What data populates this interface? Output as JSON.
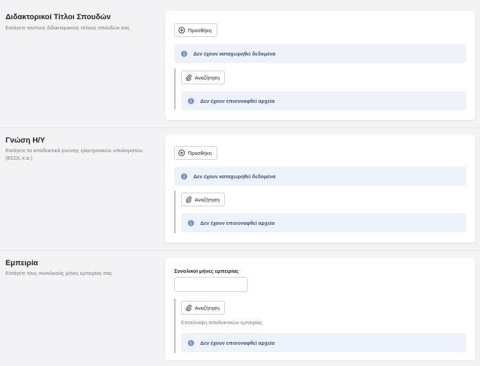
{
  "sections": [
    {
      "title": "Διδακτορικοί Τίτλοι Σπουδών",
      "description": "Εισάγετε τον/τους διδακτορικούς τίτλους σπουδών σας",
      "add_label": "Προσθήκη",
      "no_data_text": "Δεν έχουν καταχωρηθεί δεδομένα",
      "browse_label": "Αναζήτηση",
      "no_files_text": "Δεν έχουν επισυναφθεί αρχεία"
    },
    {
      "title": "Γνώση Η/Υ",
      "description": "Εισάγετε τα αποδεικτικά γνώσης ηλεκτρονικών υπολογιστών (ECDL κ.α.)",
      "add_label": "Προσθήκη",
      "no_data_text": "Δεν έχουν καταχωρηθεί δεδομένα",
      "browse_label": "Αναζήτηση",
      "no_files_text": "Δεν έχουν επισυναφθεί αρχεία"
    },
    {
      "title": "Εμπειρία",
      "description": "Εισάγετε τους συνολικούς μήνες εμπειρίας σας",
      "field_label": "Συνολικοί μήνες εμπειρίας",
      "field_value": "",
      "browse_label": "Αναζήτηση",
      "hint_text": "Επισύναψη αποδεικτικών εμπειρίας",
      "no_files_text": "Δεν έχουν επισυναφθεί αρχεία"
    }
  ],
  "colors": {
    "info_bg": "#eef3fb",
    "info_icon": "#6c95d8",
    "info_text": "#3a4f77",
    "card_bg": "#ffffff",
    "page_bg": "#f3f3f5"
  }
}
